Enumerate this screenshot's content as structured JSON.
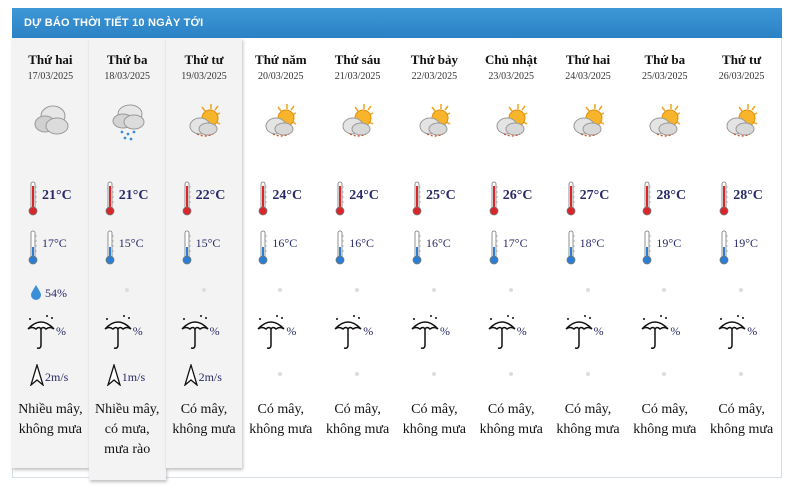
{
  "header": {
    "title": "DỰ BÁO THỜI TIẾT 10 NGÀY TỚI"
  },
  "days": [
    {
      "day": "Thứ hai",
      "date": "17/03/2025",
      "icon": "cloudy-icon",
      "high": "21°C",
      "low": "17°C",
      "humidity": "54%",
      "rain": "%",
      "wind": "2m/s",
      "desc": "Nhiều mây, không mưa"
    },
    {
      "day": "Thứ ba",
      "date": "18/03/2025",
      "icon": "rain-icon",
      "high": "21°C",
      "low": "15°C",
      "humidity": "",
      "rain": "%",
      "wind": "1m/s",
      "desc": "Nhiều mây, có mưa, mưa rào"
    },
    {
      "day": "Thứ tư",
      "date": "19/03/2025",
      "icon": "partly-cloudy-icon",
      "high": "22°C",
      "low": "15°C",
      "humidity": "",
      "rain": "%",
      "wind": "2m/s",
      "desc": "Có mây, không mưa"
    },
    {
      "day": "Thứ năm",
      "date": "20/03/2025",
      "icon": "partly-cloudy-icon",
      "high": "24°C",
      "low": "16°C",
      "humidity": "",
      "rain": "%",
      "wind": "",
      "desc": "Có mây, không mưa"
    },
    {
      "day": "Thứ sáu",
      "date": "21/03/2025",
      "icon": "partly-cloudy-icon",
      "high": "24°C",
      "low": "16°C",
      "humidity": "",
      "rain": "%",
      "wind": "",
      "desc": "Có mây, không mưa"
    },
    {
      "day": "Thứ bảy",
      "date": "22/03/2025",
      "icon": "partly-cloudy-icon",
      "high": "25°C",
      "low": "16°C",
      "humidity": "",
      "rain": "%",
      "wind": "",
      "desc": "Có mây, không mưa"
    },
    {
      "day": "Chủ nhật",
      "date": "23/03/2025",
      "icon": "partly-cloudy-icon",
      "high": "26°C",
      "low": "17°C",
      "humidity": "",
      "rain": "%",
      "wind": "",
      "desc": "Có mây, không mưa"
    },
    {
      "day": "Thứ hai",
      "date": "24/03/2025",
      "icon": "partly-cloudy-icon",
      "high": "27°C",
      "low": "18°C",
      "humidity": "",
      "rain": "%",
      "wind": "",
      "desc": "Có mây, không mưa"
    },
    {
      "day": "Thứ ba",
      "date": "25/03/2025",
      "icon": "partly-cloudy-icon",
      "high": "28°C",
      "low": "19°C",
      "humidity": "",
      "rain": "%",
      "wind": "",
      "desc": "Có mây, không mưa"
    },
    {
      "day": "Thứ tư",
      "date": "26/03/2025",
      "icon": "partly-cloudy-icon",
      "high": "28°C",
      "low": "19°C",
      "humidity": "",
      "rain": "%",
      "wind": "",
      "desc": "Có mây, không mưa"
    }
  ],
  "colors": {
    "header_bg": "#2a82c6",
    "temp_text": "#2a2a6a",
    "therm_red": "#d9262b",
    "therm_blue": "#2a7fd4"
  }
}
